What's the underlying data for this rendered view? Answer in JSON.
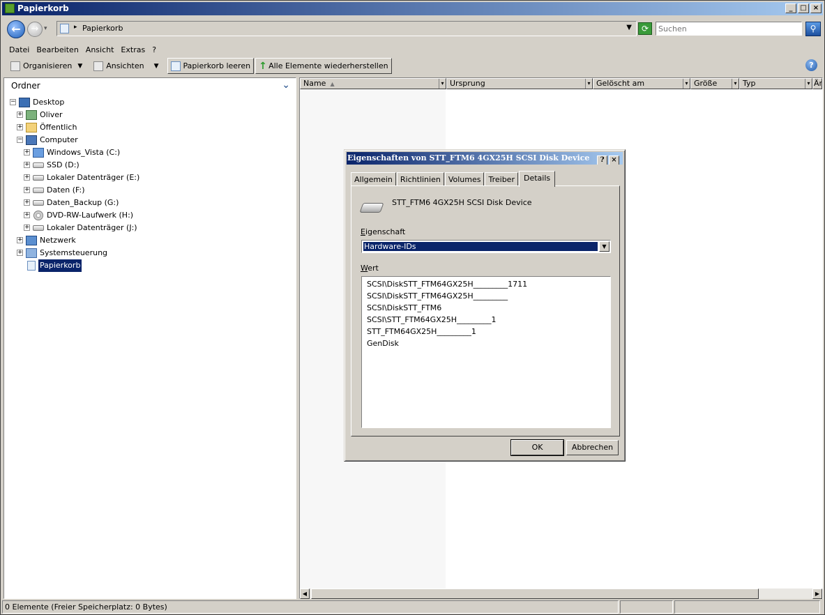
{
  "window": {
    "title": "Papierkorb",
    "controls": {
      "minimize": "_",
      "maximize": "□",
      "close": "×"
    }
  },
  "address": {
    "path": "Papierkorb",
    "search_placeholder": "Suchen"
  },
  "menu": [
    "Datei",
    "Bearbeiten",
    "Ansicht",
    "Extras",
    "?"
  ],
  "toolbar": {
    "organize": "Organisieren",
    "views": "Ansichten",
    "empty_bin": "Papierkorb leeren",
    "restore_all": "Alle Elemente wiederherstellen"
  },
  "folders": {
    "header": "Ordner",
    "tree": [
      {
        "label": "Desktop",
        "expander": "−"
      },
      {
        "label": "Oliver",
        "expander": "+"
      },
      {
        "label": "Öffentlich",
        "expander": "+"
      },
      {
        "label": "Computer",
        "expander": "−"
      },
      {
        "label": "Windows_Vista (C:)",
        "expander": "+"
      },
      {
        "label": "SSD (D:)",
        "expander": "+"
      },
      {
        "label": "Lokaler Datenträger (E:)",
        "expander": "+"
      },
      {
        "label": "Daten (F:)",
        "expander": "+"
      },
      {
        "label": "Daten_Backup (G:)",
        "expander": "+"
      },
      {
        "label": "DVD-RW-Laufwerk (H:)",
        "expander": "+"
      },
      {
        "label": "Lokaler Datenträger (J:)",
        "expander": "+"
      },
      {
        "label": "Netzwerk",
        "expander": "+"
      },
      {
        "label": "Systemsteuerung",
        "expander": "+"
      },
      {
        "label": "Papierkorb",
        "expander": ""
      }
    ]
  },
  "columns": [
    "Name",
    "Ursprung",
    "Gelöscht am",
    "Größe",
    "Typ",
    "Än"
  ],
  "status": {
    "text": "0 Elemente (Freier Speicherplatz: 0 Bytes)"
  },
  "dialog": {
    "title": "Eigenschaften von STT_FTM6 4GX25H SCSI Disk Device",
    "help": "?",
    "close": "×",
    "tabs": [
      "Allgemein",
      "Richtlinien",
      "Volumes",
      "Treiber",
      "Details"
    ],
    "device_name": "STT_FTM6 4GX25H SCSI Disk Device",
    "property_label_accel": "E",
    "property_label_rest": "igenschaft",
    "property_value": "Hardware-IDs",
    "value_label_accel": "W",
    "value_label_rest": "ert",
    "values": [
      "SCSI\\DiskSTT_FTM64GX25H_________1711",
      "SCSI\\DiskSTT_FTM64GX25H_________",
      "SCSI\\DiskSTT_FTM6",
      "SCSI\\STT_FTM64GX25H_________1",
      "STT_FTM64GX25H_________1",
      "GenDisk"
    ],
    "ok": "OK",
    "cancel": "Abbrechen"
  }
}
